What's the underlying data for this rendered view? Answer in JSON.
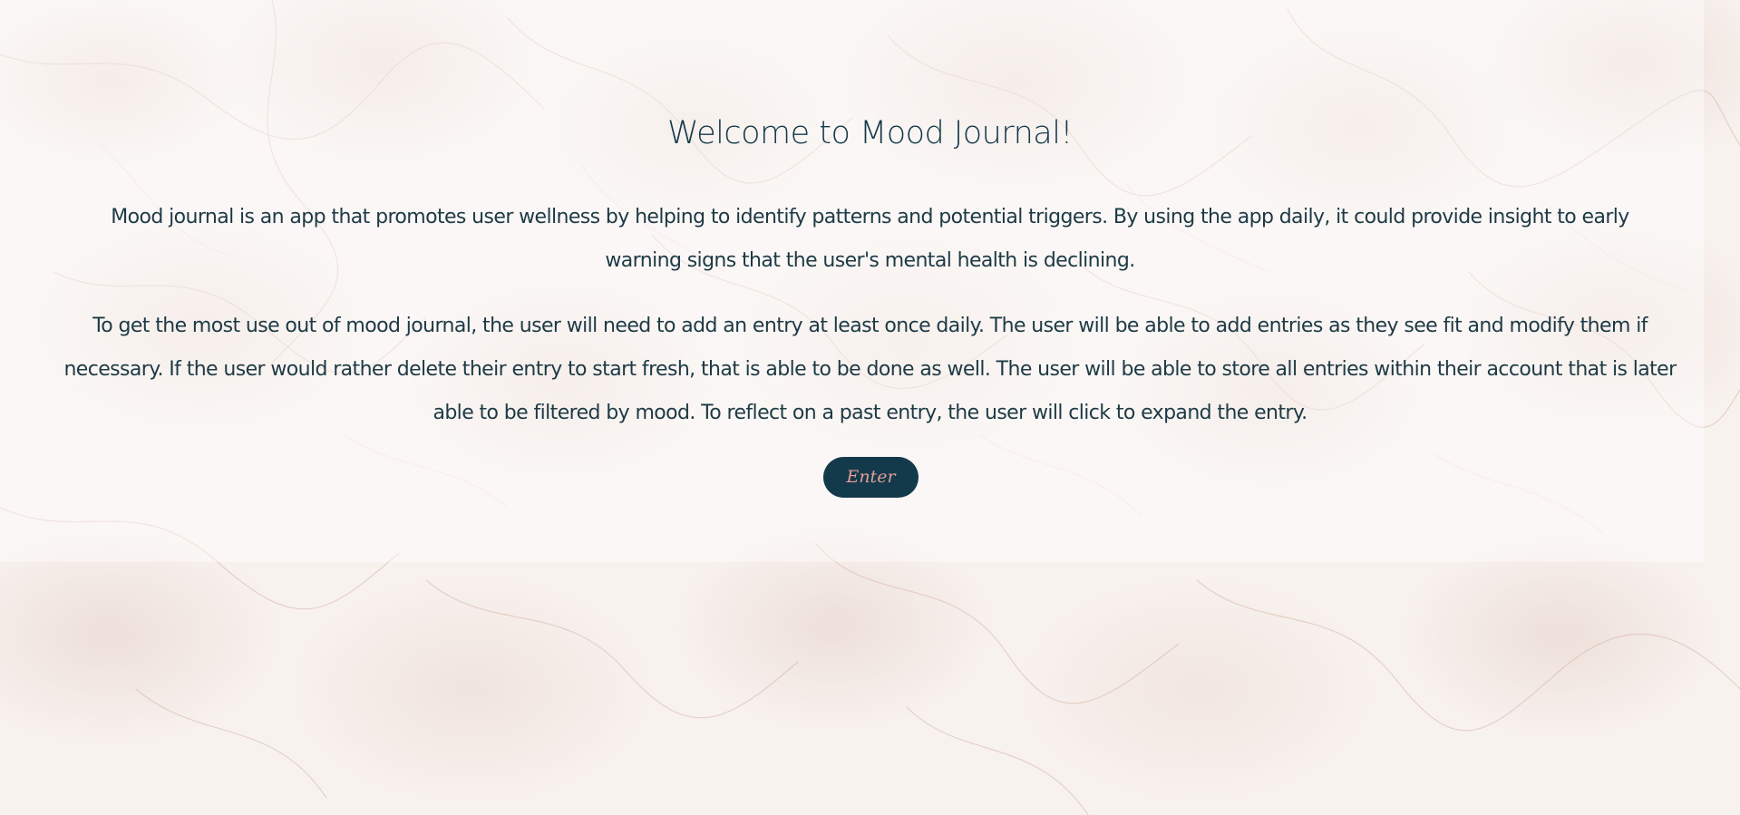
{
  "page": {
    "title": "Welcome to Mood Journal!",
    "paragraphs": [
      "Mood journal is an app that promotes user wellness by helping to identify patterns and potential triggers. By using the app daily, it could provide insight to early warning signs that the user's mental health is declining.",
      "To get the most use out of mood journal, the user will need to add an entry at least once daily. The user will be able to add entries as they see fit and modify them if necessary. If the user would rather delete their entry to start fresh, that is able to be done as well. The user will be able to store all entries within their account that is later able to be filtered by mood. To reflect on a past entry, the user will click to expand the entry."
    ],
    "enter_label": "Enter"
  },
  "colors": {
    "text": "#133a4a",
    "button_bg": "#133a4a",
    "button_text": "#e49d98",
    "background": "#f8f2ef"
  }
}
